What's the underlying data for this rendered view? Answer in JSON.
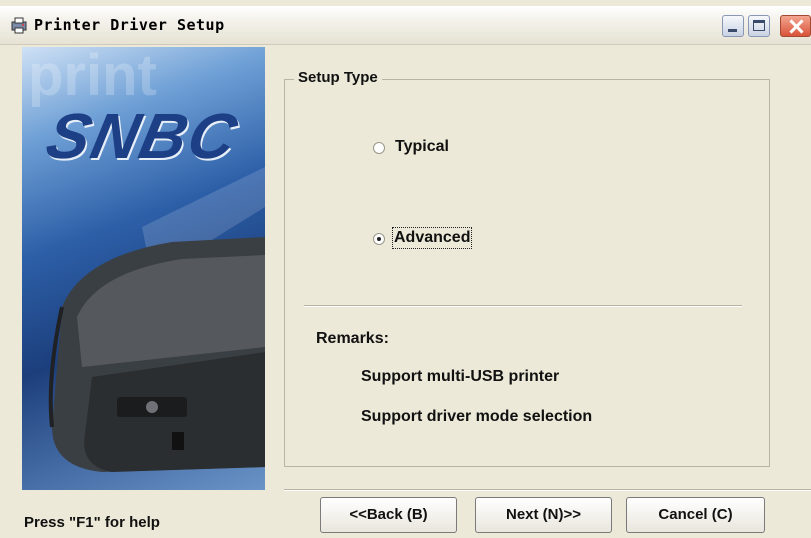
{
  "window": {
    "title": "Printer Driver Setup"
  },
  "banner": {
    "brand": "SNBC",
    "watermark": "print"
  },
  "setup_type": {
    "label": "Setup Type",
    "options": [
      {
        "label": "Typical",
        "selected": false
      },
      {
        "label": "Advanced",
        "selected": true
      }
    ]
  },
  "remarks": {
    "label": "Remarks:",
    "lines": [
      "Support multi-USB printer",
      "Support driver mode selection"
    ]
  },
  "buttons": {
    "back": "<<Back (B)",
    "next": "Next (N)>>",
    "cancel": "Cancel (C)"
  },
  "status": {
    "help": "Press \"F1\" for help"
  }
}
